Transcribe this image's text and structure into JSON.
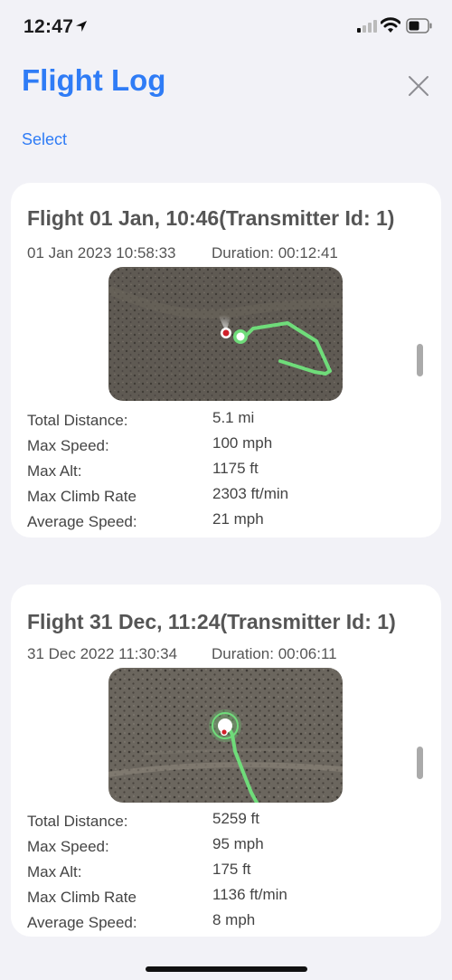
{
  "status_bar": {
    "time": "12:47"
  },
  "header": {
    "title": "Flight Log",
    "select_label": "Select"
  },
  "flights": [
    {
      "title": "Flight 01 Jan, 10:46(Transmitter Id: 1)",
      "date": "01 Jan 2023 10:58:33",
      "duration": "Duration: 00:12:41",
      "stats": [
        {
          "label": "Total Distance:",
          "value": "5.1 mi"
        },
        {
          "label": "Max Speed:",
          "value": "100 mph"
        },
        {
          "label": "Max Alt:",
          "value": "1175 ft"
        },
        {
          "label": "Max Climb Rate",
          "value": "2303 ft/min"
        },
        {
          "label": "Average Speed:",
          "value": "21 mph"
        }
      ]
    },
    {
      "title": "Flight 31 Dec, 11:24(Transmitter Id: 1)",
      "date": "31 Dec 2022 11:30:34",
      "duration": "Duration: 00:06:11",
      "stats": [
        {
          "label": "Total Distance:",
          "value": "5259 ft"
        },
        {
          "label": "Max Speed:",
          "value": "95 mph"
        },
        {
          "label": "Max Alt:",
          "value": "175 ft"
        },
        {
          "label": "Max Climb Rate",
          "value": "1136 ft/min"
        },
        {
          "label": "Average Speed:",
          "value": "8 mph"
        }
      ]
    }
  ],
  "colors": {
    "accent": "#2f7cf6",
    "track": "#6fdc7a",
    "home_marker": "#d0202a"
  }
}
